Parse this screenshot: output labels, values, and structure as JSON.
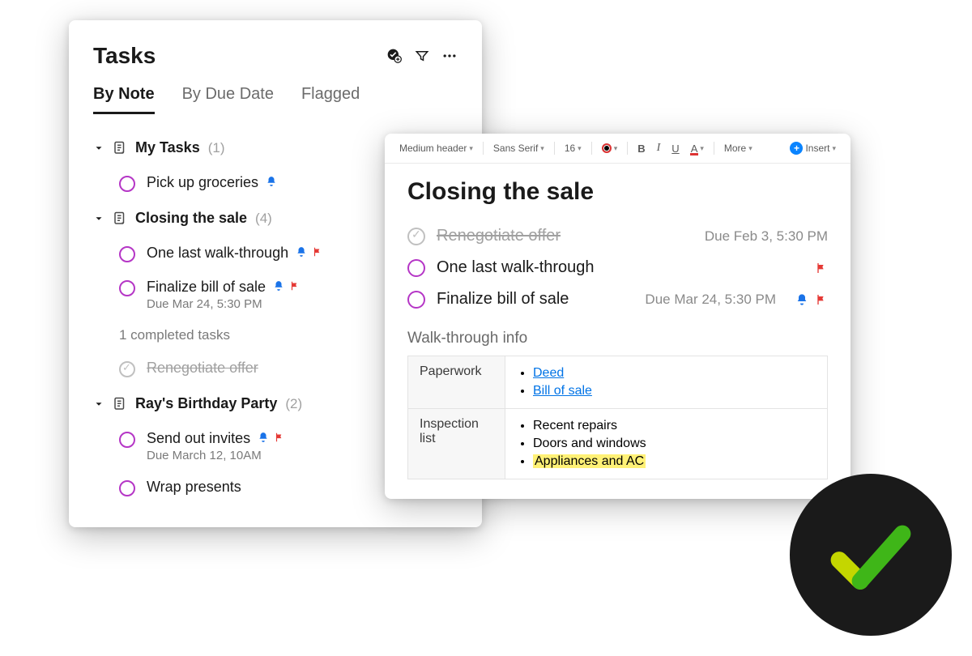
{
  "tasks_panel": {
    "title": "Tasks",
    "tabs": [
      "By Note",
      "By Due Date",
      "Flagged"
    ],
    "active_tab": 0,
    "groups": [
      {
        "title": "My Tasks",
        "count": "(1)",
        "items": [
          {
            "text": "Pick up groceries",
            "done": false,
            "bell": true,
            "flag": false,
            "meta": null
          }
        ]
      },
      {
        "title": "Closing the sale",
        "count": "(4)",
        "items": [
          {
            "text": "One last walk-through",
            "done": false,
            "bell": true,
            "flag": true,
            "meta": null
          },
          {
            "text": "Finalize bill of sale",
            "done": false,
            "bell": true,
            "flag": true,
            "meta": "Due Mar 24, 5:30 PM"
          }
        ],
        "completed_label": "1 completed tasks",
        "completed_items": [
          {
            "text": "Renegotiate offer"
          }
        ]
      },
      {
        "title": "Ray's Birthday Party",
        "count": "(2)",
        "items": [
          {
            "text": "Send out invites",
            "done": false,
            "bell": true,
            "flag": true,
            "meta": "Due March 12, 10AM"
          },
          {
            "text": "Wrap presents",
            "done": false,
            "bell": false,
            "flag": false,
            "meta": null
          }
        ]
      }
    ]
  },
  "editor": {
    "toolbar": {
      "style": "Medium header",
      "font": "Sans Serif",
      "size": "16",
      "more": "More",
      "insert": "Insert"
    },
    "title": "Closing the sale",
    "tasks": [
      {
        "text": "Renegotiate offer",
        "done": true,
        "due": "Due Feb 3, 5:30 PM",
        "bell": false,
        "flag": false
      },
      {
        "text": "One last walk-through",
        "done": false,
        "due": null,
        "bell": false,
        "flag": true
      },
      {
        "text": "Finalize bill of sale",
        "done": false,
        "due": "Due Mar 24, 5:30 PM",
        "bell": true,
        "flag": true
      }
    ],
    "subheading": "Walk-through info",
    "table": {
      "rows": [
        {
          "label": "Paperwork",
          "items": [
            {
              "text": "Deed",
              "link": true
            },
            {
              "text": "Bill of sale",
              "link": true
            }
          ]
        },
        {
          "label": "Inspection list",
          "items": [
            {
              "text": "Recent repairs"
            },
            {
              "text": "Doors and windows"
            },
            {
              "text": "Appliances and AC",
              "highlight": true
            }
          ]
        }
      ]
    }
  }
}
